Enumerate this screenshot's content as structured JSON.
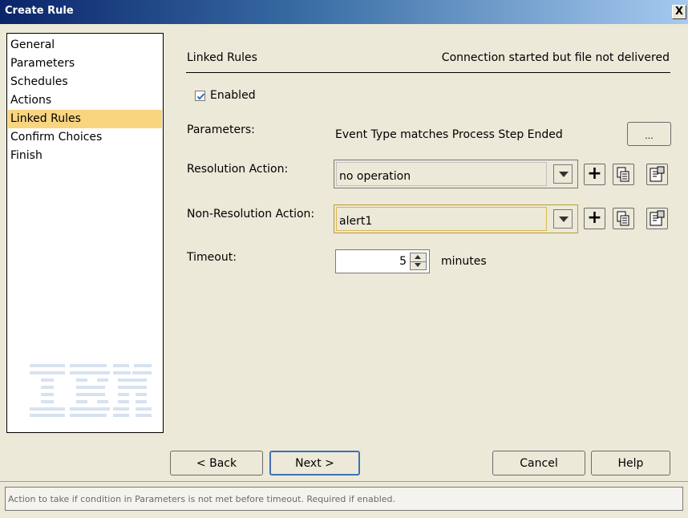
{
  "window": {
    "title": "Create Rule",
    "close_label": "X"
  },
  "nav": {
    "items": [
      {
        "label": "General"
      },
      {
        "label": "Parameters"
      },
      {
        "label": "Schedules"
      },
      {
        "label": "Actions"
      },
      {
        "label": "Linked Rules"
      },
      {
        "label": "Confirm Choices"
      },
      {
        "label": "Finish"
      }
    ],
    "selected": "Linked Rules",
    "logo": "ibm-logo"
  },
  "header": {
    "title": "Linked Rules",
    "status": "Connection started but file not delivered"
  },
  "form": {
    "enabled": {
      "label": "Enabled",
      "checked": true
    },
    "parameters": {
      "label": "Parameters:",
      "value": "Event Type matches Process Step Ended",
      "button_label": "..."
    },
    "resolution_action": {
      "label": "Resolution Action:",
      "value": "no operation"
    },
    "non_resolution_action": {
      "label": "Non-Resolution Action:",
      "value": "alert1"
    },
    "timeout": {
      "label": "Timeout:",
      "value": "5",
      "unit": "minutes"
    },
    "action_buttons": {
      "add_icon": "plus-icon",
      "copy_icon": "copy-icon",
      "properties_icon": "properties-icon"
    }
  },
  "buttons": {
    "back": "< Back",
    "next": "Next >",
    "cancel": "Cancel",
    "help": "Help"
  },
  "status_bar": {
    "text": "Action to take if condition in Parameters is not met before timeout. Required if enabled."
  },
  "colors": {
    "selection": "#f9d580",
    "title_bar_start": "#0a246a",
    "dialog_bg": "#ece9d8"
  }
}
